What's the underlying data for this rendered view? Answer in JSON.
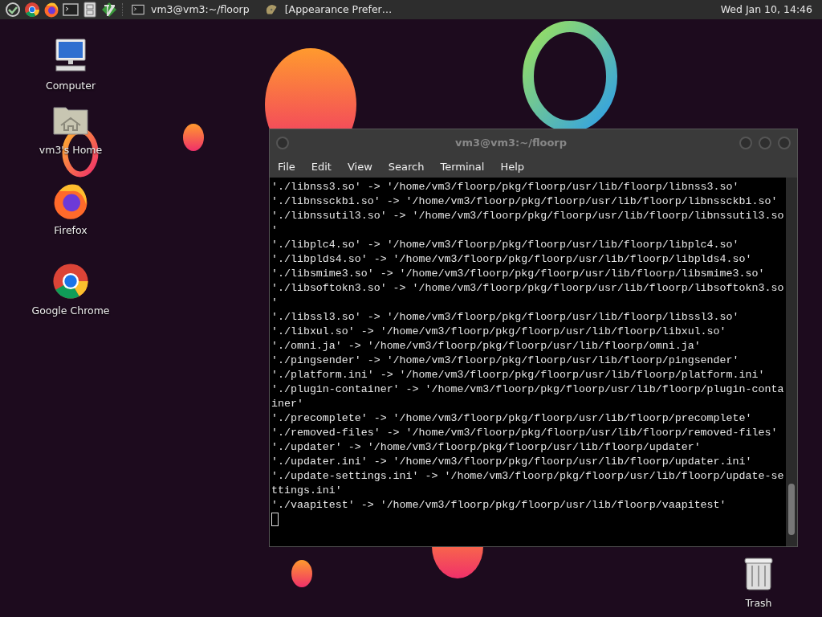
{
  "taskbar": {
    "launchers": [
      {
        "kind": "menu"
      },
      {
        "kind": "chrome"
      },
      {
        "kind": "firefox"
      },
      {
        "kind": "terminal"
      },
      {
        "kind": "files"
      },
      {
        "kind": "vim"
      }
    ],
    "tasks": [
      {
        "label": "vm3@vm3:~/floorp",
        "kind": "terminal",
        "selected": false
      },
      {
        "label": "[Appearance Prefer…",
        "kind": "appearance",
        "selected": false
      }
    ],
    "clock": "Wed Jan 10, 14:46"
  },
  "desktop_icons": [
    {
      "label": "Computer",
      "kind": "computer"
    },
    {
      "label": "vm3's Home",
      "kind": "home"
    },
    {
      "label": "Firefox",
      "kind": "firefox"
    },
    {
      "label": "Google Chrome",
      "kind": "chrome"
    },
    {
      "label": "Trash",
      "kind": "trash"
    }
  ],
  "terminal": {
    "title": "vm3@vm3:~/floorp",
    "menu": [
      "File",
      "Edit",
      "View",
      "Search",
      "Terminal",
      "Help"
    ],
    "lines": [
      "'./libnss3.so' -> '/home/vm3/floorp/pkg/floorp/usr/lib/floorp/libnss3.so'",
      "'./libnssckbi.so' -> '/home/vm3/floorp/pkg/floorp/usr/lib/floorp/libnssckbi.so'",
      "'./libnssutil3.so' -> '/home/vm3/floorp/pkg/floorp/usr/lib/floorp/libnssutil3.so",
      "'",
      "'./libplc4.so' -> '/home/vm3/floorp/pkg/floorp/usr/lib/floorp/libplc4.so'",
      "'./libplds4.so' -> '/home/vm3/floorp/pkg/floorp/usr/lib/floorp/libplds4.so'",
      "'./libsmime3.so' -> '/home/vm3/floorp/pkg/floorp/usr/lib/floorp/libsmime3.so'",
      "'./libsoftokn3.so' -> '/home/vm3/floorp/pkg/floorp/usr/lib/floorp/libsoftokn3.so",
      "'",
      "'./libssl3.so' -> '/home/vm3/floorp/pkg/floorp/usr/lib/floorp/libssl3.so'",
      "'./libxul.so' -> '/home/vm3/floorp/pkg/floorp/usr/lib/floorp/libxul.so'",
      "'./omni.ja' -> '/home/vm3/floorp/pkg/floorp/usr/lib/floorp/omni.ja'",
      "'./pingsender' -> '/home/vm3/floorp/pkg/floorp/usr/lib/floorp/pingsender'",
      "'./platform.ini' -> '/home/vm3/floorp/pkg/floorp/usr/lib/floorp/platform.ini'",
      "'./plugin-container' -> '/home/vm3/floorp/pkg/floorp/usr/lib/floorp/plugin-conta",
      "iner'",
      "'./precomplete' -> '/home/vm3/floorp/pkg/floorp/usr/lib/floorp/precomplete'",
      "'./removed-files' -> '/home/vm3/floorp/pkg/floorp/usr/lib/floorp/removed-files'",
      "'./updater' -> '/home/vm3/floorp/pkg/floorp/usr/lib/floorp/updater'",
      "'./updater.ini' -> '/home/vm3/floorp/pkg/floorp/usr/lib/floorp/updater.ini'",
      "'./update-settings.ini' -> '/home/vm3/floorp/pkg/floorp/usr/lib/floorp/update-se",
      "ttings.ini'",
      "'./vaapitest' -> '/home/vm3/floorp/pkg/floorp/usr/lib/floorp/vaapitest'"
    ]
  }
}
